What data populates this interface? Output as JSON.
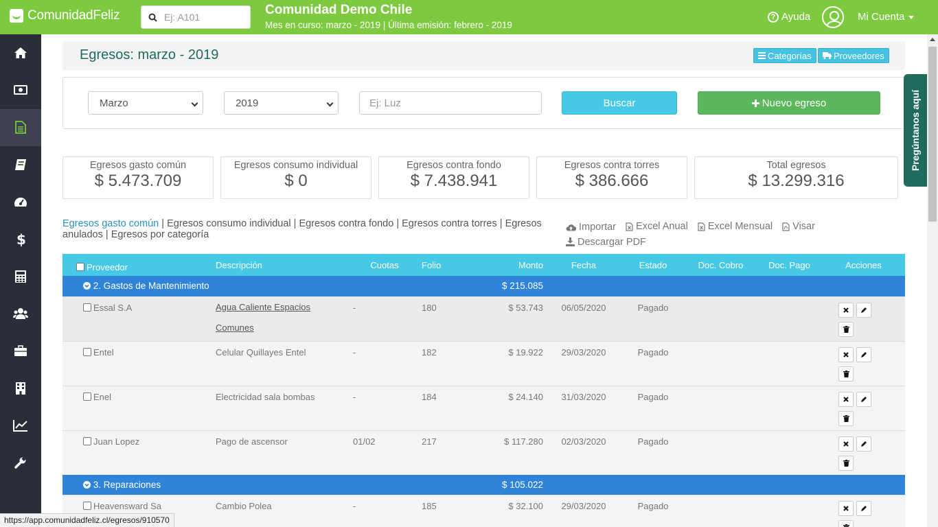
{
  "topbar": {
    "brand": "ComunidadFeliz",
    "search_placeholder": "Ej: A101",
    "community_name": "Comunidad Demo Chile",
    "period_info": "Mes en curso: marzo - 2019 | Última emisión: febrero - 2019",
    "help_label": "Ayuda",
    "account_label": "Mi Cuenta"
  },
  "sidebar": {
    "items": [
      {
        "icon": "home-icon"
      },
      {
        "icon": "money-bill-icon"
      },
      {
        "icon": "document-icon",
        "active": true
      },
      {
        "icon": "book-icon"
      },
      {
        "icon": "dashboard-icon"
      },
      {
        "icon": "dollar-icon"
      },
      {
        "icon": "calculator-icon"
      },
      {
        "icon": "users-icon"
      },
      {
        "icon": "briefcase-icon"
      },
      {
        "icon": "building-icon"
      },
      {
        "icon": "chart-line-icon"
      },
      {
        "icon": "wrench-icon"
      }
    ]
  },
  "page": {
    "title": "Egresos: marzo - 2019",
    "categories_btn": "Categorías",
    "providers_btn": "Proveedores"
  },
  "filters": {
    "month": "Marzo",
    "year": "2019",
    "query_placeholder": "Ej: Luz",
    "search_btn": "Buscar",
    "new_btn": "Nuevo egreso"
  },
  "ask_tab": "Pregúntanos aquí",
  "stats": [
    {
      "label": "Egresos gasto común",
      "value": "$ 5.473.709"
    },
    {
      "label": "Egresos consumo individual",
      "value": "$ 0"
    },
    {
      "label": "Egresos contra fondo",
      "value": "$ 7.438.941"
    },
    {
      "label": "Egresos contra torres",
      "value": "$ 386.666"
    },
    {
      "label": "Total egresos",
      "value": "$ 13.299.316"
    }
  ],
  "links": {
    "gasto_comun": "Egresos gasto común",
    "consumo": "Egresos consumo individual",
    "fondo": "Egresos contra fondo",
    "torres": "Egresos contra torres",
    "anulados": "Egresos anulados",
    "categoria": "Egresos por categoría"
  },
  "actions": {
    "importar": "Importar",
    "excel_anual": "Excel Anual",
    "excel_mensual": "Excel Mensual",
    "visar": "Visar",
    "descargar_pdf": "Descargar PDF"
  },
  "table": {
    "headers": {
      "proveedor": "Proveedor",
      "descripcion": "Descripción",
      "cuotas": "Cuotas",
      "folio": "Folio",
      "monto": "Monto",
      "fecha": "Fecha",
      "estado": "Estado",
      "doc_cobro": "Doc. Cobro",
      "doc_pago": "Doc. Pago",
      "acciones": "Acciones"
    },
    "groups": [
      {
        "name": "2. Gastos de Mantenimiento",
        "total": "$ 215.085",
        "rows": [
          {
            "proveedor": "Essal S.A",
            "descripcion": "Agua Caliente Espacios Comunes",
            "cuotas": "-",
            "folio": "180",
            "monto": "$ 53.743",
            "fecha": "06/05/2020",
            "estado": "Pagado"
          },
          {
            "proveedor": "Entel",
            "descripcion": "Celular Quillayes Entel",
            "cuotas": "-",
            "folio": "182",
            "monto": "$ 19.922",
            "fecha": "29/03/2020",
            "estado": "Pagado"
          },
          {
            "proveedor": "Enel",
            "descripcion": "Electricidad sala bombas",
            "cuotas": "-",
            "folio": "184",
            "monto": "$ 24.140",
            "fecha": "31/03/2020",
            "estado": "Pagado"
          },
          {
            "proveedor": "Juan Lopez",
            "descripcion": "Pago de ascensor",
            "cuotas": "01/02",
            "folio": "217",
            "monto": "$ 117.280",
            "fecha": "02/03/2020",
            "estado": "Pagado"
          }
        ]
      },
      {
        "name": "3. Reparaciones",
        "total": "$ 105.022",
        "rows": [
          {
            "proveedor": "Heavensward Sa",
            "descripcion": "Cambio Polea",
            "cuotas": "-",
            "folio": "185",
            "monto": "$ 32.100",
            "fecha": "29/03/2020",
            "estado": "Pagado"
          }
        ]
      }
    ]
  },
  "status_url": "https://app.comunidadfeliz.cl/egresos/910570"
}
